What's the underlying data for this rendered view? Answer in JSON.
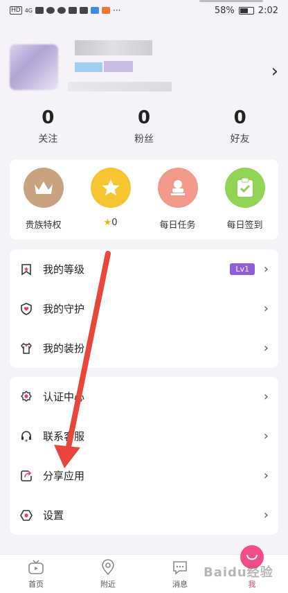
{
  "status_bar": {
    "network": "HD",
    "signal": "4G",
    "more": "···",
    "battery_percent": "58%",
    "time": "2:02"
  },
  "profile": {
    "stats": [
      {
        "value": "0",
        "label": "关注"
      },
      {
        "value": "0",
        "label": "粉丝"
      },
      {
        "value": "0",
        "label": "好友"
      }
    ]
  },
  "grid": [
    {
      "label": "贵族特权",
      "icon": "crown-icon",
      "color": "#c9a380"
    },
    {
      "label": "0",
      "icon": "star-icon",
      "color": "#f7c531",
      "prefix_icon": "star-icon"
    },
    {
      "label": "每日任务",
      "icon": "stamp-icon",
      "color": "#f29a8a"
    },
    {
      "label": "每日签到",
      "icon": "clipboard-check-icon",
      "color": "#8fd454"
    }
  ],
  "menu_group1": [
    {
      "label": "我的等级",
      "icon": "star-bookmark-icon",
      "badge": "Lv1"
    },
    {
      "label": "我的守护",
      "icon": "shield-heart-icon"
    },
    {
      "label": "我的装扮",
      "icon": "shirt-icon"
    }
  ],
  "menu_group2": [
    {
      "label": "认证中心",
      "icon": "badge-icon"
    },
    {
      "label": "联系客服",
      "icon": "headset-icon"
    },
    {
      "label": "分享应用",
      "icon": "share-icon"
    },
    {
      "label": "设置",
      "icon": "settings-hexagon-icon"
    }
  ],
  "bottom_nav": [
    {
      "label": "首页",
      "icon": "tv-icon"
    },
    {
      "label": "附近",
      "icon": "location-pin-icon"
    },
    {
      "label": "消息",
      "icon": "chat-icon"
    },
    {
      "label": "我",
      "icon": "me-icon",
      "active": true
    }
  ],
  "watermark": "Baidu经验",
  "colors": {
    "accent": "#e03c7a",
    "level_badge": "#8e5fd6",
    "annotation_arrow": "#e8463a"
  }
}
